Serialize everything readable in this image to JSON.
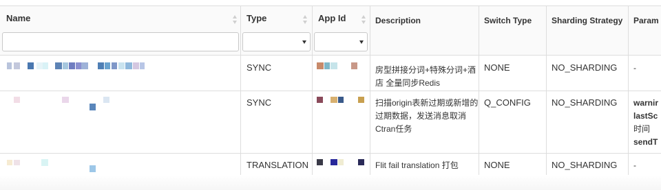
{
  "columns": {
    "name": "Name",
    "type": "Type",
    "app_id": "App Id",
    "description": "Description",
    "switch_type": "Switch Type",
    "sharding_strategy": "Sharding Strategy",
    "params": "Param"
  },
  "filters": {
    "name_value": "",
    "type_selected": "",
    "app_id_selected": ""
  },
  "rows": [
    {
      "type": "SYNC",
      "description": "房型拼接分词+特殊分词+酒店 全量同步Redis",
      "switch_type": "NONE",
      "sharding_strategy": "NO_SHARDING",
      "params_lines": [
        "-"
      ]
    },
    {
      "type": "SYNC",
      "description": "扫描origin表新过期或新增的过期数据，发送消息取消Ctran任务",
      "switch_type": "Q_CONFIG",
      "sharding_strategy": "NO_SHARDING",
      "params_lines": [
        "warnir",
        "lastSc",
        "时间",
        "sendT"
      ]
    },
    {
      "type": "TRANSLATION",
      "description": "Flit fail translation 打包",
      "switch_type": "NONE",
      "sharding_strategy": "NO_SHARDING",
      "params_lines": [
        "-"
      ]
    }
  ],
  "colors": {
    "header_bg": "#fafafa",
    "border": "#dddddd",
    "text": "#333333"
  },
  "icons": [
    "sort-icon",
    "dropdown-caret-icon"
  ]
}
